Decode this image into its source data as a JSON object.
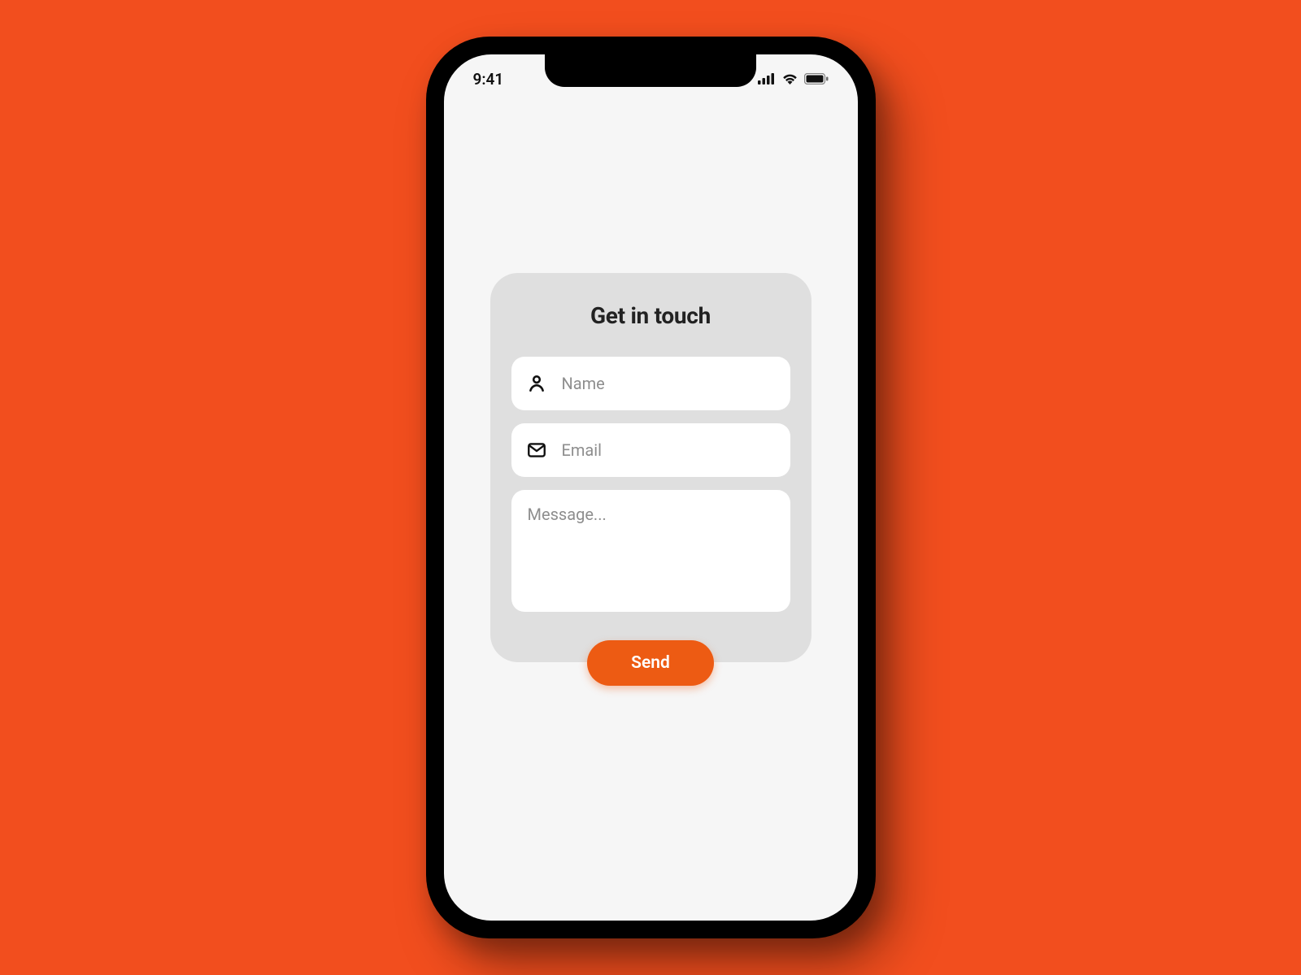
{
  "status": {
    "time": "9:41"
  },
  "form": {
    "title": "Get in touch",
    "name": {
      "placeholder": "Name",
      "value": ""
    },
    "email": {
      "placeholder": "Email",
      "value": ""
    },
    "message": {
      "placeholder": "Message...",
      "value": ""
    },
    "submit_label": "Send"
  },
  "colors": {
    "background": "#f24e1e",
    "accent": "#ed5b13",
    "card": "#dfdfdf",
    "field": "#ffffff"
  }
}
